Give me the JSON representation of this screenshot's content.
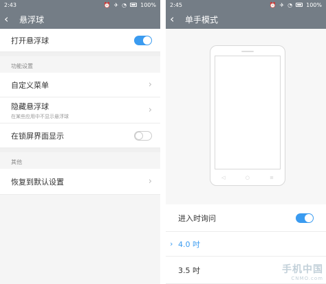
{
  "left": {
    "status": {
      "time": "2:43",
      "battery": "100%"
    },
    "title": "悬浮球",
    "toggle_row": {
      "label": "打开悬浮球",
      "on": true
    },
    "section1": "功能设置",
    "custom_menu": "自定义菜单",
    "hide_row": {
      "label": "隐藏悬浮球",
      "sub": "在某些应用中不显示悬浮球"
    },
    "lock_row": {
      "label": "在锁屏界面显示",
      "on": false
    },
    "section2": "其他",
    "restore": "恢复到默认设置"
  },
  "right": {
    "status": {
      "time": "2:45",
      "battery": "100%"
    },
    "title": "单手模式",
    "ask_row": {
      "label": "进入时询问",
      "on": true
    },
    "options": [
      {
        "label": "4.0 吋",
        "selected": true
      },
      {
        "label": "3.5 吋",
        "selected": false
      }
    ]
  },
  "watermark": {
    "main": "手机中国",
    "sub": "CNMO.com"
  },
  "colors": {
    "header": "#747d86",
    "accent": "#3a9bf0"
  }
}
